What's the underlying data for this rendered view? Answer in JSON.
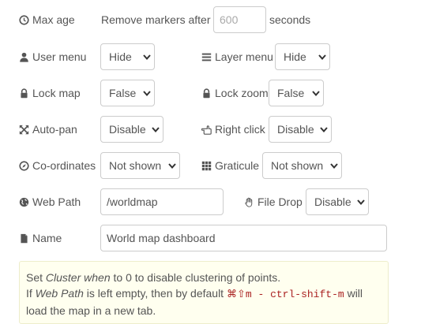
{
  "max_age": {
    "label": "Max age",
    "prefix": "Remove markers after",
    "placeholder": "600",
    "suffix": "seconds"
  },
  "user_menu": {
    "label": "User menu",
    "value": "Hide"
  },
  "layer_menu": {
    "label": "Layer menu",
    "value": "Hide"
  },
  "lock_map": {
    "label": "Lock map",
    "value": "False"
  },
  "lock_zoom": {
    "label": "Lock zoom",
    "value": "False"
  },
  "auto_pan": {
    "label": "Auto-pan",
    "value": "Disable"
  },
  "right_click": {
    "label": "Right click",
    "value": "Disable"
  },
  "coordinates": {
    "label": "Co-ordinates",
    "value": "Not shown"
  },
  "graticule": {
    "label": "Graticule",
    "value": "Not shown"
  },
  "web_path": {
    "label": "Web Path",
    "value": "/worldmap"
  },
  "file_drop": {
    "label": "File Drop",
    "value": "Disable"
  },
  "name": {
    "label": "Name",
    "value": "World map dashboard"
  },
  "tip": {
    "t1": "Set ",
    "i1": "Cluster when",
    "t2": " to 0 to disable clustering of points.",
    "t3": "If ",
    "i2": "Web Path",
    "t4": " is left empty, then by default ",
    "code": "⌘⇧m - ctrl-shift-m",
    "t5": " will load the map in a new tab."
  }
}
